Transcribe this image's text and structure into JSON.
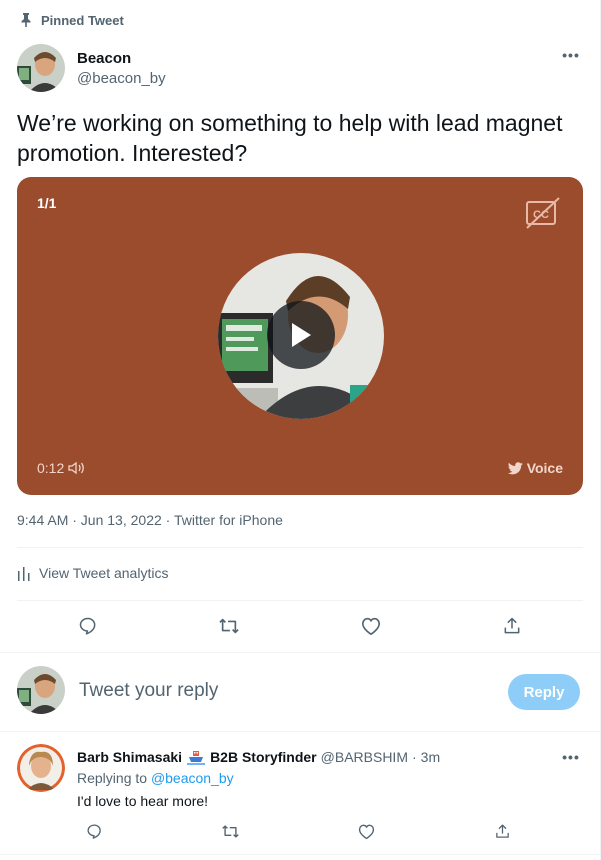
{
  "pinned": {
    "label": "Pinned Tweet",
    "icon": "pin-icon"
  },
  "author": {
    "name": "Beacon",
    "handle": "@beacon_by",
    "more": "•••"
  },
  "tweet": {
    "text": "We’re working on something to help with lead magnet promotion. Interested?"
  },
  "media": {
    "counter": "1/1",
    "duration": "0:12",
    "voice_label": "Voice",
    "background": "#9b4c2d"
  },
  "meta": {
    "timestamp": "9:44 AM · Jun 13, 2022 · Twitter for iPhone"
  },
  "analytics": {
    "label": "View Tweet analytics"
  },
  "actions": [
    "reply-icon",
    "retweet-icon",
    "like-icon",
    "share-icon"
  ],
  "composer": {
    "placeholder": "Tweet your reply",
    "button": "Reply"
  },
  "reply": {
    "name": "Barb Shimasaki",
    "name_suffix": "B2B Storyfinder",
    "handle": "@BARBSHIM",
    "separator": "·",
    "time": "3m",
    "replying_prefix": "Replying to",
    "replying_to": "@beacon_by",
    "text": "I'd love to hear more!",
    "more": "•••"
  },
  "colors": {
    "accent": "#1d9bf0",
    "reply_button": "#8ecdf8",
    "muted": "#536471"
  }
}
